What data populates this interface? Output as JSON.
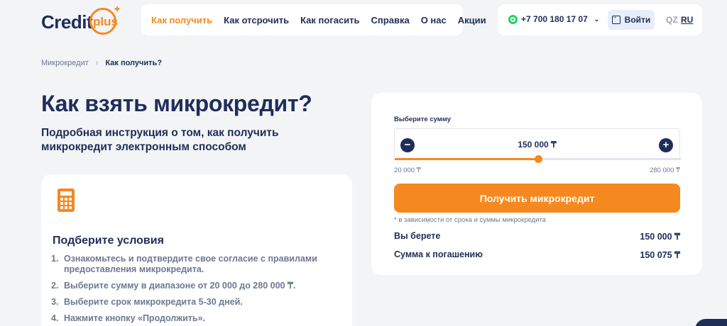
{
  "logo": {
    "word": "Credit",
    "plus": "plus"
  },
  "nav": [
    {
      "label": "Как получить"
    },
    {
      "label": "Как отсрочить"
    },
    {
      "label": "Как погасить"
    },
    {
      "label": "Справка"
    },
    {
      "label": "О нас"
    },
    {
      "label": "Акции"
    }
  ],
  "header": {
    "phone": "+7 700 180 17 07",
    "login_label": "Войти",
    "lang_qz": "QZ",
    "lang_ru": "RU"
  },
  "breadcrumb": {
    "parent": "Микрокредит",
    "separator": "›",
    "current": "Как получить?"
  },
  "page": {
    "title": "Как взять микрокредит?",
    "subtitle": "Подробная инструкция о том, как получить микрокредит электронным способом"
  },
  "steps_card": {
    "title": "Подберите условия",
    "steps": [
      {
        "num": "1.",
        "text": "Ознакомьтесь и подтвердите свое согласие с правилами предоставления микрокредита."
      },
      {
        "num": "2.",
        "text": "Выберите сумму в диапазоне от 20 000 до 280 000 ₸."
      },
      {
        "num": "3.",
        "text": "Выберите срок микрокредита 5-30 дней."
      },
      {
        "num": "4.",
        "text": "Нажмите кнопку «Продолжить»."
      }
    ]
  },
  "calculator": {
    "label": "Выберите сумму",
    "amount": "150 000 ₸",
    "minus": "−",
    "plus": "+",
    "slider_fraction": 0.5,
    "min_label": "20 000 ₸",
    "max_label": "280 000 ₸",
    "cta": "Получить микрокредит",
    "note": "* в зависимости от срока и суммы микрокредита",
    "take_label": "Вы берете",
    "take_value": "150 000 ₸",
    "repay_label": "Сумма к погашению",
    "repay_value": "150 075 ₸"
  },
  "colors": {
    "accent": "#f5891f",
    "primary": "#1f2d5a",
    "whatsapp": "#25d366"
  }
}
